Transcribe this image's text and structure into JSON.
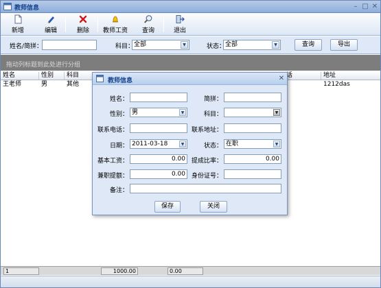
{
  "window": {
    "title": "教师信息"
  },
  "toolbar": {
    "add": "新增",
    "edit": "编辑",
    "delete": "删除",
    "salary": "教师工资",
    "query": "查询",
    "exit": "退出"
  },
  "search": {
    "name_label": "姓名/简拼：",
    "name_value": "",
    "subject_label": "科目：",
    "subject_value": "全部",
    "status_label": "状态：",
    "status_value": "全部",
    "query_button": "查询",
    "export_button": "导出"
  },
  "group_panel": {
    "hint": "拖动列标题到此处进行分组"
  },
  "grid": {
    "columns": [
      "姓名",
      "性别",
      "科目",
      "话",
      "地址"
    ],
    "rows": [
      [
        "王老师",
        "男",
        "其他",
        "1212das"
      ]
    ]
  },
  "footer": {
    "count": "1",
    "total1": "1000.00",
    "total2": "0.00"
  },
  "modal": {
    "title": "教师信息",
    "labels": {
      "name": "姓名：",
      "pinyin": "简拼：",
      "gender": "性别：",
      "subject": "科目：",
      "phone": "联系电话：",
      "address": "联系地址：",
      "date": "日期：",
      "status": "状态：",
      "base_salary": "基本工资：",
      "commission": "提成比率：",
      "parttime": "兼职提额：",
      "idcard": "身份证号：",
      "remark": "备注："
    },
    "values": {
      "name": "",
      "pinyin": "",
      "gender": "男",
      "subject": "",
      "phone": "",
      "address": "",
      "date": "2011-03-18",
      "status": "在职",
      "base_salary": "0.00",
      "commission": "0.00",
      "parttime": "0.00",
      "idcard": "",
      "remark": ""
    },
    "save_button": "保存",
    "close_button": "关闭"
  }
}
